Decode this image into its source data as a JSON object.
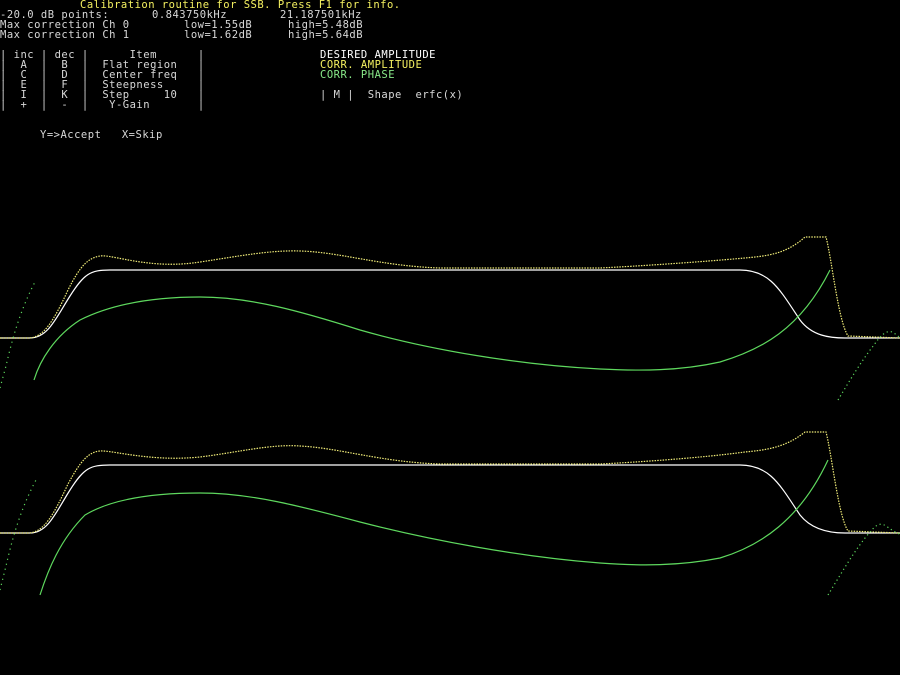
{
  "header": {
    "title": "Calibration routine for SSB. Press F1 for info.",
    "points_label": "-20.0 dB points:",
    "points_low": "0.843750kHz",
    "points_high": "21.187501kHz",
    "ch0_label": "Max correction Ch 0",
    "ch0_low": "low=1.55dB",
    "ch0_high": "high=5.48dB",
    "ch1_label": "Max correction Ch 1",
    "ch1_low": "low=1.62dB",
    "ch1_high": "high=5.64dB"
  },
  "keytable": {
    "header": "| inc | dec |      Item      |",
    "rows": [
      "|  A  |  B  |  Flat region   |",
      "|  C  |  D  |  Center freq   |",
      "|  E  |  F  |  Steepness     |",
      "|  I  |  K  |  Step     10   |",
      "|  +  |  -  |   Y-Gain       |"
    ]
  },
  "legend": {
    "desired": "DESIRED AMPLITUDE",
    "corr_amp": "CORR. AMPLITUDE",
    "corr_phase": "CORR. PHASE",
    "shape_line": "| M |  Shape  erfc(x)"
  },
  "prompt": "Y=>Accept   X=Skip",
  "colors": {
    "background": "#000000",
    "title": "#f4f060",
    "desired": "#ffffff",
    "corr_amplitude": "#f0ec78",
    "corr_phase": "#5ed85e",
    "text": "#d8d8d8"
  }
}
